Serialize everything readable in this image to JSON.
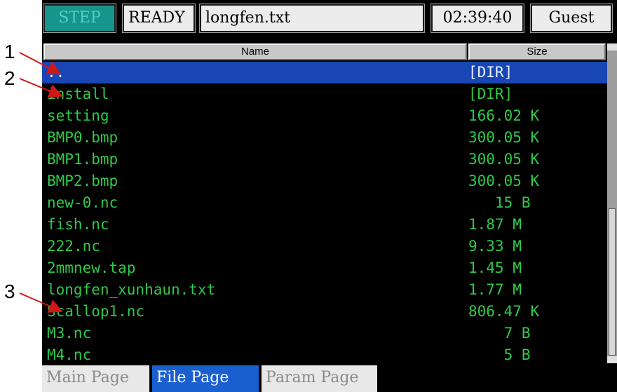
{
  "status": {
    "mode": "STEP",
    "state": "READY",
    "file": "longfen.txt",
    "time": "02:39:40",
    "user": "Guest"
  },
  "columns": {
    "name": "Name",
    "size": "Size"
  },
  "files": [
    {
      "name": "..",
      "size": "[DIR]",
      "selected": true
    },
    {
      "name": "install",
      "size": "[DIR]"
    },
    {
      "name": "setting",
      "size": "166.02 K"
    },
    {
      "name": "BMP0.bmp",
      "size": "300.05 K"
    },
    {
      "name": "BMP1.bmp",
      "size": "300.05 K"
    },
    {
      "name": "BMP2.bmp",
      "size": "300.05 K"
    },
    {
      "name": "new-0.nc",
      "size": "   15 B"
    },
    {
      "name": "fish.nc",
      "size": "1.87 M"
    },
    {
      "name": "222.nc",
      "size": "9.33 M"
    },
    {
      "name": "2mmnew.tap",
      "size": "1.45 M"
    },
    {
      "name": "longfen_xunhaun.txt",
      "size": "1.77 M"
    },
    {
      "name": "Scallop1.nc",
      "size": "806.47 K"
    },
    {
      "name": "M3.nc",
      "size": "    7 B"
    },
    {
      "name": "M4.nc",
      "size": "    5 B"
    }
  ],
  "tabs": [
    "Main Page",
    "File Page",
    "Param Page"
  ],
  "active_tab": 1,
  "annotations": [
    "1",
    "2",
    "3"
  ],
  "colors": {
    "file_text": "#2fc94a",
    "selected_row": "#1846b4",
    "mode_bg": "#15958c",
    "active_tab": "#1a5fd0"
  }
}
